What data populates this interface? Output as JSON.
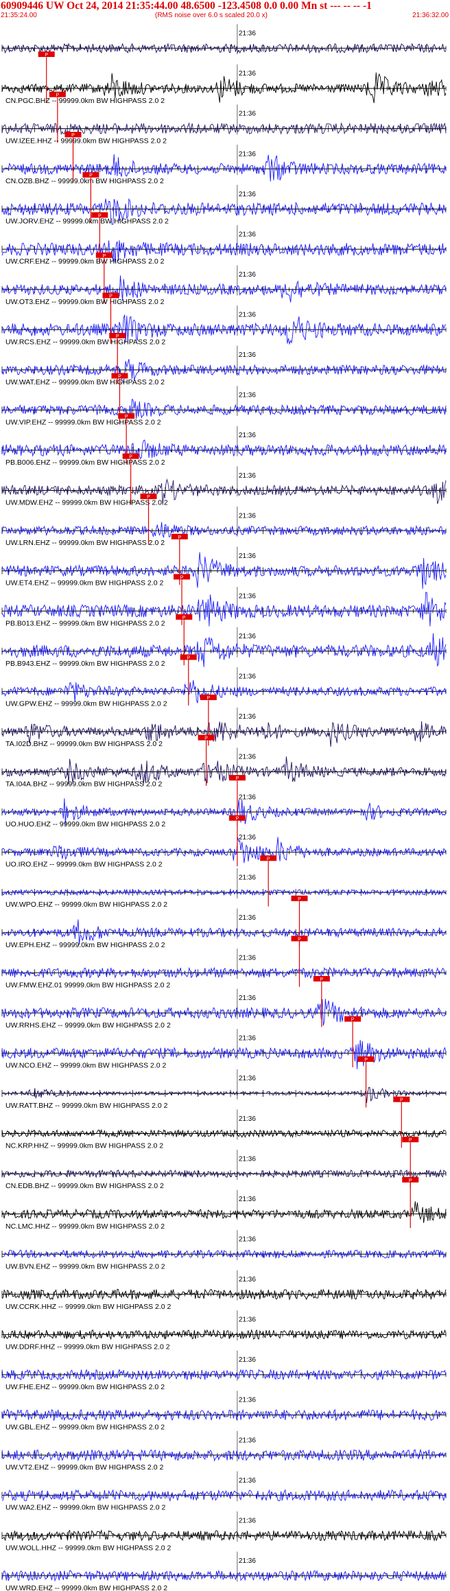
{
  "header": {
    "title": "60909446 UW Oct 24, 2014 21:35:44.00   48.6500 -123.4508  0.0 0.00 Mn st --- -- --  -1",
    "start_time": "21:35:24.00",
    "subtitle": "(RMS noise over 6.0 s scaled 20.0 x)",
    "end_time": "21:36:32.00"
  },
  "chart_data": {
    "type": "line",
    "title": "60909446 UW Oct 24, 2014 21:35:44.00   48.6500 -123.4508  0.0 0.00 Mn st --- -- --  -1",
    "x_unit": "time (UTC)",
    "x_start": "21:35:24.00",
    "x_end": "21:36:32.00",
    "time_label": "21:36",
    "pick_label": "P",
    "filter_label": "HIGHPASS  2.0  2",
    "colors": {
      "text": "#e00000",
      "pick": "#e00000",
      "blue": "#1a1aff",
      "navy": "#1c1060",
      "black": "#000000",
      "purple": "#2a1a6a"
    },
    "traces": [
      {
        "label": "",
        "color": "#1c1060",
        "amp": 0.25,
        "pick": null,
        "events": []
      },
      {
        "label": "CN.PGC.BHZ -- 99999.0km BW  HIGHPASS  2.0  2",
        "color": "#000000",
        "amp": 0.25,
        "pick": 0.1,
        "events": [
          [
            0.24,
            0.8
          ],
          [
            0.49,
            0.7
          ],
          [
            0.83,
            1.0
          ],
          [
            0.96,
            0.6
          ]
        ]
      },
      {
        "label": "UW.IZEE.HHZ -- 99999.0km BW  HIGHPASS  2.0  2",
        "color": "#2a1a6a",
        "amp": 0.3,
        "pick": 0.125,
        "events": []
      },
      {
        "label": "CN.OZB.BHZ -- 99999.0km BW  HIGHPASS  2.0  2",
        "color": "#1a1aff",
        "amp": 0.3,
        "pick": 0.16,
        "events": [
          [
            0.25,
            0.55
          ],
          [
            0.6,
            0.75
          ]
        ]
      },
      {
        "label": "UW.JORV.EHZ -- 99999.0km BW  HIGHPASS  2.0  2",
        "color": "#1a1aff",
        "amp": 0.35,
        "pick": 0.2,
        "events": [
          [
            0.24,
            0.8
          ]
        ]
      },
      {
        "label": "UW.CRF.EHZ -- 99999.0km BW  HIGHPASS  2.0  2",
        "color": "#1a1aff",
        "amp": 0.35,
        "pick": 0.22,
        "events": [
          [
            0.25,
            0.5
          ]
        ]
      },
      {
        "label": "UW.OT3.EHZ -- 99999.0km BW  HIGHPASS  2.0  2",
        "color": "#1a1aff",
        "amp": 0.3,
        "pick": 0.23,
        "events": [
          [
            0.26,
            0.6
          ],
          [
            0.64,
            0.7
          ]
        ]
      },
      {
        "label": "UW.RCS.EHZ -- 99999.0km BW  HIGHPASS  2.0  2",
        "color": "#1a1aff",
        "amp": 0.35,
        "pick": 0.245,
        "events": [
          [
            0.27,
            0.7
          ],
          [
            0.64,
            1.0
          ]
        ]
      },
      {
        "label": "UW.WAT.EHZ -- 99999.0km BW  HIGHPASS  2.0  2",
        "color": "#1a1aff",
        "amp": 0.28,
        "pick": 0.26,
        "events": [
          [
            0.27,
            0.6
          ]
        ]
      },
      {
        "label": "UW.VIP.EHZ -- 99999.0km BW  HIGHPASS  2.0  2",
        "color": "#1a1aff",
        "amp": 0.28,
        "pick": 0.265,
        "events": [
          [
            0.28,
            0.5
          ]
        ]
      },
      {
        "label": "PB.B006.EHZ -- 99999.0km BW  HIGHPASS  2.0  2",
        "color": "#1a1aff",
        "amp": 0.32,
        "pick": 0.28,
        "events": [
          [
            0.29,
            0.6
          ]
        ]
      },
      {
        "label": "UW.MDW.EHZ -- 99999.0km BW  HIGHPASS  2.0  2",
        "color": "#2a1a6a",
        "amp": 0.28,
        "pick": 0.29,
        "events": [
          [
            0.36,
            0.6
          ],
          [
            0.98,
            0.5
          ]
        ]
      },
      {
        "label": "UW.LRN.EHZ -- 99999.0km BW  HIGHPASS  2.0  2",
        "color": "#1a1aff",
        "amp": 0.25,
        "pick": 0.33,
        "events": [
          [
            0.35,
            0.4
          ]
        ]
      },
      {
        "label": "UW.ET4.EHZ -- 99999.0km BW  HIGHPASS  2.0  2",
        "color": "#1a1aff",
        "amp": 0.3,
        "pick": 0.4,
        "events": [
          [
            0.44,
            1.0
          ],
          [
            0.94,
            0.9
          ]
        ]
      },
      {
        "label": "PB.B013.EHZ -- 99999.0km BW  HIGHPASS  2.0  2",
        "color": "#1a1aff",
        "amp": 0.35,
        "pick": 0.405,
        "events": [
          [
            0.45,
            1.0
          ],
          [
            0.95,
            0.9
          ]
        ]
      },
      {
        "label": "PB.B943.EHZ -- 99999.0km BW  HIGHPASS  2.0  2",
        "color": "#1a1aff",
        "amp": 0.35,
        "pick": 0.41,
        "events": [
          [
            0.45,
            0.9
          ],
          [
            0.97,
            0.8
          ]
        ]
      },
      {
        "label": "UW.GPW.EHZ -- 99999.0km BW  HIGHPASS  2.0  2",
        "color": "#1a1aff",
        "amp": 0.25,
        "pick": 0.42,
        "events": [
          [
            0.15,
            0.5
          ],
          [
            0.42,
            0.8
          ]
        ]
      },
      {
        "label": "TA.I02D.BHZ -- 99999.0km BW  HIGHPASS  2.0  2",
        "color": "#1c1060",
        "amp": 0.25,
        "pick": 0.465,
        "events": [
          [
            0.06,
            0.5
          ],
          [
            0.33,
            0.6
          ],
          [
            0.47,
            0.9
          ],
          [
            0.58,
            0.5
          ],
          [
            0.74,
            0.6
          ],
          [
            0.93,
            0.5
          ]
        ]
      },
      {
        "label": "TA.I04A.BHZ -- 99999.0km BW  HIGHPASS  2.0  2",
        "color": "#1c1060",
        "amp": 0.25,
        "pick": 0.46,
        "events": [
          [
            0.15,
            0.5
          ],
          [
            0.31,
            0.7
          ],
          [
            0.46,
            0.9
          ],
          [
            0.64,
            0.6
          ]
        ]
      },
      {
        "label": "UO.HUO.EHZ -- 99999.0km BW  HIGHPASS  2.0  2",
        "color": "#1a1aff",
        "amp": 0.2,
        "pick": 0.53,
        "events": [
          [
            0.14,
            0.6
          ],
          [
            0.53,
            0.8
          ],
          [
            0.82,
            0.4
          ]
        ]
      },
      {
        "label": "UO.IRO.EHZ -- 99999.0km BW  HIGHPASS  2.0  2",
        "color": "#1a1aff",
        "amp": 0.22,
        "pick": 0.53,
        "events": [
          [
            0.12,
            0.5
          ],
          [
            0.53,
            0.9
          ],
          [
            0.62,
            0.6
          ]
        ]
      },
      {
        "label": "UW.WPO.EHZ -- 99999.0km BW  HIGHPASS  2.0  2",
        "color": "#1a1aff",
        "amp": 0.15,
        "pick": 0.6,
        "events": []
      },
      {
        "label": "UW.EPH.EHZ -- 99999.0km BW  HIGHPASS  2.0  2",
        "color": "#1a1aff",
        "amp": 0.25,
        "pick": 0.67,
        "events": [
          [
            0.17,
            0.6
          ]
        ]
      },
      {
        "label": "UW.FMW.EHZ.01 99999.0km BW  HIGHPASS  2.0  2",
        "color": "#1a1aff",
        "amp": 0.28,
        "pick": 0.67,
        "events": []
      },
      {
        "label": "UW.RRHS.EHZ -- 99999.0km BW  HIGHPASS  2.0  2",
        "color": "#1a1aff",
        "amp": 0.3,
        "pick": 0.72,
        "events": [
          [
            0.72,
            0.7
          ]
        ]
      },
      {
        "label": "UW.NCO.EHZ -- 99999.0km BW  HIGHPASS  2.0  2",
        "color": "#1a1aff",
        "amp": 0.3,
        "pick": 0.79,
        "events": [
          [
            0.8,
            0.7
          ]
        ]
      },
      {
        "label": "UW.RATT.BHZ -- 99999.0km BW  HIGHPASS  2.0  2",
        "color": "#1c1060",
        "amp": 0.1,
        "pick": 0.82,
        "events": [
          [
            0.07,
            0.4
          ],
          [
            0.82,
            0.5
          ]
        ]
      },
      {
        "label": "NC.KRP.HHZ -- 99999.0km BW  HIGHPASS  2.0  2",
        "color": "#000000",
        "amp": 0.2,
        "pick": 0.9,
        "events": []
      },
      {
        "label": "CN.EDB.BHZ -- 99999.0km BW  HIGHPASS  2.0  2",
        "color": "#1c1060",
        "amp": 0.2,
        "pick": 0.92,
        "events": []
      },
      {
        "label": "NC.LMC.HHZ -- 99999.0km BW  HIGHPASS  2.0  2",
        "color": "#000000",
        "amp": 0.25,
        "pick": 0.92,
        "events": [
          [
            0.93,
            0.5
          ]
        ]
      },
      {
        "label": "UW.BVN.EHZ -- 99999.0km BW  HIGHPASS  2.0  2",
        "color": "#1a1aff",
        "amp": 0.22,
        "pick": null,
        "events": []
      },
      {
        "label": "UW.CCRK.HHZ -- 99999.0km BW  HIGHPASS  2.0  2",
        "color": "#000000",
        "amp": 0.28,
        "pick": null,
        "events": []
      },
      {
        "label": "UW.DDRF.HHZ -- 99999.0km BW  HIGHPASS  2.0  2",
        "color": "#000000",
        "amp": 0.25,
        "pick": null,
        "events": []
      },
      {
        "label": "UW.FHE.EHZ -- 99999.0km BW  HIGHPASS  2.0  2",
        "color": "#1a1aff",
        "amp": 0.28,
        "pick": null,
        "events": []
      },
      {
        "label": "UW.GBL.EHZ -- 99999.0km BW  HIGHPASS  2.0  2",
        "color": "#1a1aff",
        "amp": 0.3,
        "pick": null,
        "events": []
      },
      {
        "label": "UW.VT2.EHZ -- 99999.0km BW  HIGHPASS  2.0  2",
        "color": "#1a1aff",
        "amp": 0.3,
        "pick": null,
        "events": []
      },
      {
        "label": "UW.WA2.EHZ -- 99999.0km BW  HIGHPASS  2.0  2",
        "color": "#1a1aff",
        "amp": 0.3,
        "pick": null,
        "events": []
      },
      {
        "label": "UW.WOLL.HHZ -- 99999.0km BW  HIGHPASS  2.0  2",
        "color": "#000000",
        "amp": 0.28,
        "pick": null,
        "events": []
      },
      {
        "label": "UW.WRD.EHZ -- 99999.0km BW  HIGHPASS  2.0  2",
        "color": "#1a1aff",
        "amp": 0.28,
        "pick": null,
        "events": []
      }
    ]
  }
}
